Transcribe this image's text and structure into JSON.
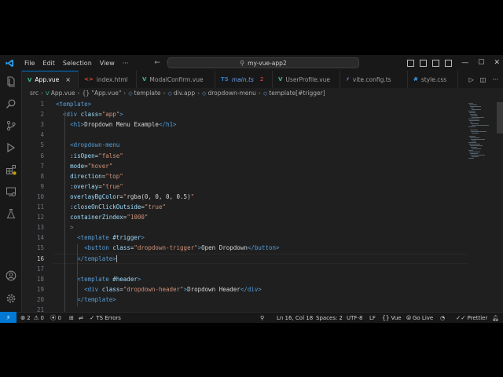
{
  "titlebar": {
    "menus": [
      "File",
      "Edit",
      "Selection",
      "View",
      "···"
    ],
    "search_text": "my-vue-app2"
  },
  "tabs": [
    {
      "label": "App.vue",
      "icon": "V",
      "icon_color": "#41b883",
      "active": true,
      "close": "×"
    },
    {
      "label": "index.html",
      "icon": "<>",
      "icon_color": "#e44d26"
    },
    {
      "label": "ModalConfirm.vue",
      "icon": "V",
      "icon_color": "#41b883"
    },
    {
      "label": "main.ts",
      "icon": "TS",
      "icon_color": "#3178c6",
      "count": "2"
    },
    {
      "label": "UserProfile.vue",
      "icon": "V",
      "icon_color": "#41b883"
    },
    {
      "label": "vite.config.ts",
      "icon": "⚡",
      "icon_color": "#bd93f9"
    },
    {
      "label": "style.css",
      "icon": "#",
      "icon_color": "#42a5f5"
    }
  ],
  "breadcrumbs": [
    "src",
    "App.vue",
    "{} \"App.vue\"",
    "template",
    "div.app",
    "dropdown-menu",
    "template[#trigger]"
  ],
  "editor": {
    "current_line": 16,
    "lines": [
      {
        "n": "1",
        "t": [
          [
            "tag",
            "<template>"
          ]
        ]
      },
      {
        "n": "2",
        "t": [
          [
            "txt",
            "  "
          ],
          [
            "tag",
            "<div "
          ],
          [
            "attr",
            "class"
          ],
          [
            "txt",
            "="
          ],
          [
            "str",
            "\"app\""
          ],
          [
            "tag",
            ">"
          ]
        ]
      },
      {
        "n": "3",
        "t": [
          [
            "txt",
            "    "
          ],
          [
            "tag",
            "<h1>"
          ],
          [
            "txt",
            "Dropdown Menu Example"
          ],
          [
            "tag",
            "</h1>"
          ]
        ]
      },
      {
        "n": "4",
        "t": [
          [
            "txt",
            ""
          ]
        ]
      },
      {
        "n": "5",
        "t": [
          [
            "txt",
            "    "
          ],
          [
            "tag",
            "<dropdown-menu"
          ]
        ]
      },
      {
        "n": "6",
        "t": [
          [
            "txt",
            "    "
          ],
          [
            "attr",
            ":isOpen"
          ],
          [
            "txt",
            "="
          ],
          [
            "str",
            "\"false\""
          ]
        ]
      },
      {
        "n": "7",
        "t": [
          [
            "txt",
            "    "
          ],
          [
            "attr",
            "mode"
          ],
          [
            "txt",
            "="
          ],
          [
            "str",
            "\"hover\""
          ]
        ]
      },
      {
        "n": "8",
        "t": [
          [
            "txt",
            "    "
          ],
          [
            "attr",
            "direction"
          ],
          [
            "txt",
            "="
          ],
          [
            "str",
            "\"top\""
          ]
        ]
      },
      {
        "n": "9",
        "t": [
          [
            "txt",
            "    "
          ],
          [
            "attr",
            ":overlay"
          ],
          [
            "txt",
            "="
          ],
          [
            "str",
            "\"true\""
          ]
        ]
      },
      {
        "n": "10",
        "t": [
          [
            "txt",
            "    "
          ],
          [
            "attr",
            "overlayBgColor"
          ],
          [
            "txt",
            "="
          ],
          [
            "str",
            "\""
          ],
          [
            "txt",
            "rgba(0, 0, 0, 0.5)"
          ],
          [
            "str",
            "\""
          ]
        ]
      },
      {
        "n": "11",
        "t": [
          [
            "txt",
            "    "
          ],
          [
            "attr",
            ":closeOnClickOutside"
          ],
          [
            "txt",
            "="
          ],
          [
            "str",
            "\"true\""
          ]
        ]
      },
      {
        "n": "12",
        "t": [
          [
            "txt",
            "    "
          ],
          [
            "attr",
            "containerZindex"
          ],
          [
            "txt",
            "="
          ],
          [
            "str",
            "\"1000\""
          ]
        ]
      },
      {
        "n": "13",
        "t": [
          [
            "txt",
            "    "
          ],
          [
            "br",
            ">"
          ]
        ]
      },
      {
        "n": "14",
        "t": [
          [
            "txt",
            "      "
          ],
          [
            "tag",
            "<template "
          ],
          [
            "attr",
            "#trigger"
          ],
          [
            "tag",
            ">"
          ]
        ]
      },
      {
        "n": "15",
        "t": [
          [
            "txt",
            "        "
          ],
          [
            "tag",
            "<button "
          ],
          [
            "attr",
            "class"
          ],
          [
            "txt",
            "="
          ],
          [
            "str",
            "\"dropdown-trigger\""
          ],
          [
            "tag",
            ">"
          ],
          [
            "txt",
            "Open Dropdown"
          ],
          [
            "tag",
            "</button>"
          ]
        ]
      },
      {
        "n": "16",
        "t": [
          [
            "txt",
            "      "
          ],
          [
            "tag",
            "</template>"
          ],
          [
            "cursor",
            ""
          ]
        ]
      },
      {
        "n": "17",
        "t": [
          [
            "txt",
            ""
          ]
        ]
      },
      {
        "n": "18",
        "t": [
          [
            "txt",
            "      "
          ],
          [
            "tag",
            "<template "
          ],
          [
            "attr",
            "#header"
          ],
          [
            "tag",
            ">"
          ]
        ]
      },
      {
        "n": "19",
        "t": [
          [
            "txt",
            "        "
          ],
          [
            "tag",
            "<div "
          ],
          [
            "attr",
            "class"
          ],
          [
            "txt",
            "="
          ],
          [
            "str",
            "\"dropdown-header\""
          ],
          [
            "tag",
            ">"
          ],
          [
            "txt",
            "Dropdown Header"
          ],
          [
            "tag",
            "</div>"
          ]
        ]
      },
      {
        "n": "20",
        "t": [
          [
            "txt",
            "      "
          ],
          [
            "tag",
            "</template>"
          ]
        ]
      },
      {
        "n": "21",
        "t": [
          [
            "txt",
            ""
          ]
        ]
      }
    ]
  },
  "statusbar": {
    "remote": "⚡",
    "errors": "2",
    "warnings": "0",
    "ports": "0",
    "ts_errors": "TS Errors",
    "position": "Ln 16, Col 18",
    "spaces": "Spaces: 2",
    "encoding": "UTF-8",
    "eol": "LF",
    "language": "Vue",
    "golive": "Go Live",
    "prettier": "Prettier"
  },
  "colors": {
    "accent": "#0078d4",
    "tag": "#569cd6",
    "attr": "#9cdcfe",
    "string": "#ce9178",
    "error": "#f14c4c"
  }
}
